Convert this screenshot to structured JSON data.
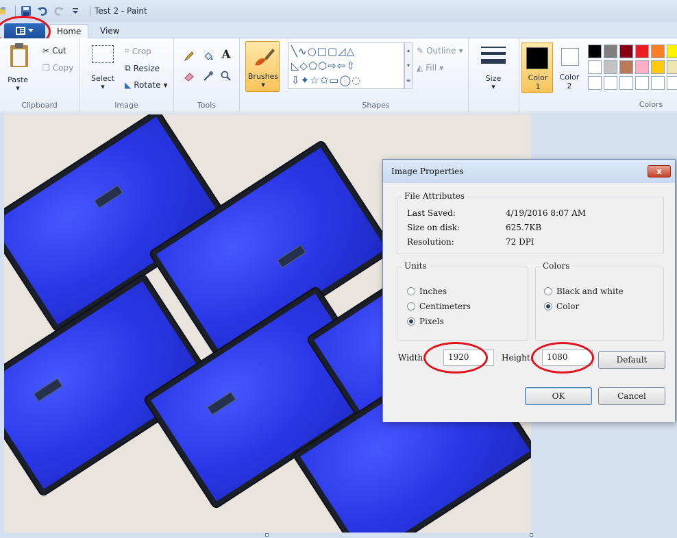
{
  "window": {
    "title": "Test 2 - Paint"
  },
  "tabs": {
    "home": "Home",
    "view": "View"
  },
  "ribbon": {
    "clipboard": {
      "label": "Clipboard",
      "paste": "Paste",
      "cut": "Cut",
      "copy": "Copy"
    },
    "image": {
      "label": "Image",
      "select": "Select",
      "crop": "Crop",
      "resize": "Resize",
      "rotate": "Rotate"
    },
    "tools": {
      "label": "Tools"
    },
    "brushes": {
      "label": "Brushes"
    },
    "shapes": {
      "label": "Shapes",
      "outline": "Outline",
      "fill": "Fill"
    },
    "size": {
      "label": "Size"
    },
    "color1": {
      "line1": "Color",
      "line2": "1"
    },
    "color2": {
      "line1": "Color",
      "line2": "2"
    },
    "colors": {
      "label": "Colors",
      "palette": [
        "#000000",
        "#7f7f7f",
        "#880015",
        "#ed1c24",
        "#ff7f27",
        "#fff200",
        "#ffffff",
        "#c3c3c3",
        "#b97a57",
        "#ffaec9",
        "#ffc90e",
        "#efe4b0",
        "#ffffff",
        "#ffffff",
        "#ffffff",
        "#ffffff",
        "#ffffff",
        "#ffffff"
      ]
    }
  },
  "dialog": {
    "title": "Image Properties",
    "close": "x",
    "file_attributes": {
      "label": "File Attributes",
      "last_saved_label": "Last Saved:",
      "last_saved_value": "4/19/2016 8:07 AM",
      "size_label": "Size on disk:",
      "size_value": "625.7KB",
      "resolution_label": "Resolution:",
      "resolution_value": "72 DPI"
    },
    "units": {
      "label": "Units",
      "inches": "Inches",
      "centimeters": "Centimeters",
      "pixels": "Pixels",
      "selected": "Pixels"
    },
    "colors": {
      "label": "Colors",
      "bw": "Black and white",
      "color": "Color",
      "selected": "Color"
    },
    "width_label": "Width:",
    "width_value": "1920",
    "height_label": "Height:",
    "height_value": "1080",
    "default_button": "Default",
    "ok_button": "OK",
    "cancel_button": "Cancel"
  },
  "accent": {
    "highlight_circle": "#e0121b",
    "file_tab": "#1c4f9a"
  }
}
